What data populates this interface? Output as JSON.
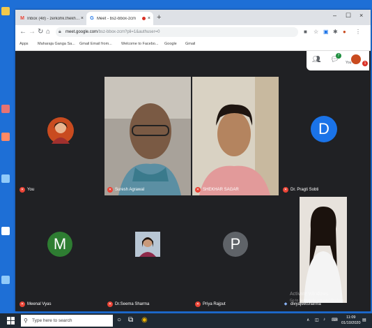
{
  "browser": {
    "tabs": [
      {
        "label": "Inbox (48) - zerkohk.thekhawat...",
        "favicon_text": "M",
        "color": "#ea4335",
        "active": false
      },
      {
        "label": "Meet - bsz-bbox-zcm",
        "favicon_text": "G",
        "color": "#1a73e8",
        "active": true,
        "recording": true
      }
    ],
    "window_controls": {
      "minimize": "–",
      "maximize": "☐",
      "close": "×"
    },
    "new_tab_label": "+",
    "url_host": "meet.google.com",
    "url_path": "/bsz-bbox-zcm?pli=1&authuser=0",
    "bookmarks": [
      "Apps",
      "Maharaja Ganga Sa...",
      "Gmail Email from...",
      "Welcome to Facebo...",
      "Google",
      "Gmail"
    ],
    "nav_icons": [
      "back-icon",
      "forward-icon",
      "reload-icon",
      "home-icon"
    ]
  },
  "meet": {
    "participants": [
      {
        "name": "You",
        "type": "photo-avatar",
        "avatar_color": "#c94b1f",
        "muted": true
      },
      {
        "name": "Suresh Agrawal",
        "type": "video",
        "muted": true
      },
      {
        "name": "SHEKHAR SAGAR",
        "type": "video",
        "muted": true
      },
      {
        "name": "Dr. Pragti Sobti",
        "type": "letter-avatar",
        "initial": "D",
        "avatar_color": "#1a73e8",
        "muted": true
      },
      {
        "name": "Meenal Vyas",
        "type": "letter-avatar",
        "initial": "M",
        "avatar_color": "#2e7d32",
        "muted": true
      },
      {
        "name": "Dr.Seema Sharma",
        "type": "photo-avatar",
        "avatar_color": "#7b3f3f",
        "muted": true
      },
      {
        "name": "Priya Rajput",
        "type": "letter-avatar",
        "initial": "P",
        "avatar_color": "#5f6368",
        "muted": true
      },
      {
        "name": "divyajeetsharma",
        "type": "video",
        "muted": false
      }
    ],
    "top_panel": {
      "people_count": "7",
      "self_label": "You",
      "notification_count": "1"
    },
    "watermark": {
      "line1": "Activate Windows",
      "line2": "Go to Settings to activate Windows."
    }
  },
  "taskbar": {
    "search_placeholder": "Type here to search",
    "time": "11:09",
    "date": "01/10/2020"
  }
}
